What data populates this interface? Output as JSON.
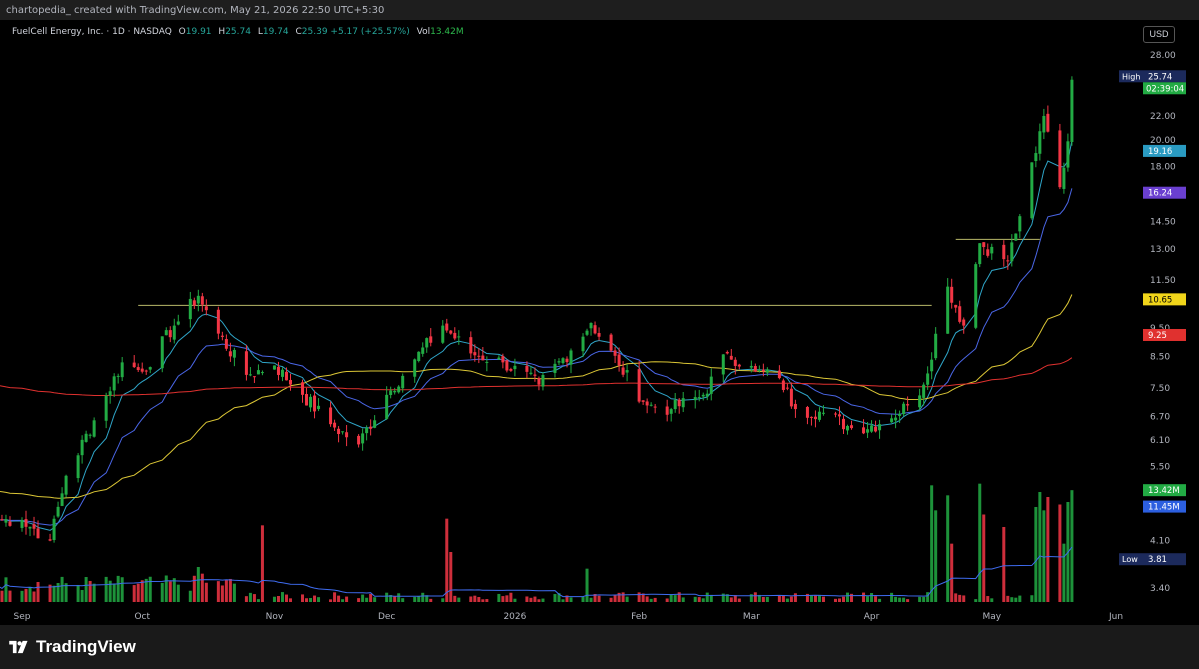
{
  "header": {
    "attribution": "chartopedia_ created with TradingView.com, May 21, 2026 22:50 UTC+5:30"
  },
  "legend": {
    "symbol": "FuelCell Energy, Inc. · 1D · NASDAQ",
    "open_label": "O",
    "open": "19.91",
    "high_label": "H",
    "high": "25.74",
    "low_label": "L",
    "low": "19.74",
    "close_label": "C",
    "close": "25.39",
    "change": "+5.17 (+25.57%)",
    "vol_label": "Vol",
    "vol": "13.42M"
  },
  "currency_button": "USD",
  "footer": {
    "brand": "TradingView"
  },
  "colors": {
    "up": "#22ab44",
    "down": "#f23645",
    "ema_short": "#2fa5c8",
    "ema_mid": "#4a66e6",
    "sma_50": "#dcc736",
    "sma_200": "#e0312f",
    "resistance": "#b9b96a",
    "vol_ma": "#3f6cf0",
    "background": "#000000"
  },
  "chart_data": {
    "type": "candlestick",
    "price_scale": "log",
    "y_ticks": [
      "28.00",
      "22.00",
      "20.00",
      "18.00",
      "14.50",
      "13.00",
      "11.50",
      "9.50",
      "8.50",
      "7.50",
      "6.70",
      "6.10",
      "5.50",
      "5.00",
      "4.10",
      "3.40"
    ],
    "x_ticks": [
      {
        "label": "Sep",
        "date": "2025-09-01"
      },
      {
        "label": "Oct",
        "date": "2025-10-01"
      },
      {
        "label": "Nov",
        "date": "2025-11-03"
      },
      {
        "label": "Dec",
        "date": "2025-12-01"
      },
      {
        "label": "2026",
        "date": "2026-01-02"
      },
      {
        "label": "Feb",
        "date": "2026-02-02"
      },
      {
        "label": "Mar",
        "date": "2026-03-02"
      },
      {
        "label": "Apr",
        "date": "2026-04-01"
      },
      {
        "label": "May",
        "date": "2026-05-01"
      },
      {
        "label": "Jun",
        "date": "2026-06-01"
      }
    ],
    "price_labels": [
      {
        "label": "High",
        "value": "25.74",
        "price": 25.74,
        "color": "#1c2a5c",
        "sub": "02:39:04"
      },
      {
        "value": "19.16",
        "price": 19.16,
        "color": "#2a9bc2"
      },
      {
        "value": "16.24",
        "price": 16.24,
        "color": "#6a3fd0"
      },
      {
        "value": "10.65",
        "price": 10.65,
        "color": "#f1d51a"
      },
      {
        "value": "9.25",
        "price": 9.25,
        "color": "#e0312f"
      },
      {
        "value": "13.42M",
        "volume": 13.42,
        "color": "#22ab44"
      },
      {
        "value": "11.45M",
        "volume": 11.45,
        "color": "#2c5fe0"
      },
      {
        "label": "Low",
        "value": "3.81",
        "price": 3.81,
        "color": "#1c2a5c"
      }
    ],
    "resistance_lines": [
      {
        "from": "2025-09-30",
        "to": "2026-04-16",
        "price": 10.4
      },
      {
        "from": "2026-04-22",
        "to": "2026-05-13",
        "price": 13.5
      }
    ],
    "close_anchors": [
      [
        "2025-09-01",
        4.45
      ],
      [
        "2025-09-08",
        4.1
      ],
      [
        "2025-09-12",
        5.3
      ],
      [
        "2025-09-19",
        6.6
      ],
      [
        "2025-09-26",
        8.3
      ],
      [
        "2025-10-01",
        8.0
      ],
      [
        "2025-10-09",
        9.6
      ],
      [
        "2025-10-15",
        10.8
      ],
      [
        "2025-10-20",
        9.3
      ],
      [
        "2025-10-27",
        7.9
      ],
      [
        "2025-11-03",
        8.2
      ],
      [
        "2025-11-10",
        7.3
      ],
      [
        "2025-11-17",
        6.5
      ],
      [
        "2025-11-24",
        6.0
      ],
      [
        "2025-12-01",
        7.3
      ],
      [
        "2025-12-08",
        8.4
      ],
      [
        "2025-12-15",
        9.6
      ],
      [
        "2025-12-22",
        8.6
      ],
      [
        "2025-12-30",
        8.3
      ],
      [
        "2026-01-08",
        7.6
      ],
      [
        "2026-01-16",
        8.7
      ],
      [
        "2026-01-21",
        9.7
      ],
      [
        "2026-01-28",
        8.2
      ],
      [
        "2026-02-04",
        7.0
      ],
      [
        "2026-02-10",
        6.9
      ],
      [
        "2026-02-18",
        7.3
      ],
      [
        "2026-02-24",
        8.6
      ],
      [
        "2026-03-03",
        8.0
      ],
      [
        "2026-03-09",
        7.8
      ],
      [
        "2026-03-13",
        6.9
      ],
      [
        "2026-03-20",
        6.8
      ],
      [
        "2026-03-27",
        6.4
      ],
      [
        "2026-04-03",
        6.5
      ],
      [
        "2026-04-10",
        7.0
      ],
      [
        "2026-04-14",
        7.6
      ],
      [
        "2026-04-20",
        11.2
      ],
      [
        "2026-04-24",
        9.6
      ],
      [
        "2026-04-28",
        13.3
      ],
      [
        "2026-05-05",
        12.4
      ],
      [
        "2026-05-08",
        14.8
      ],
      [
        "2026-05-12",
        19.0
      ],
      [
        "2026-05-14",
        22.0
      ],
      [
        "2026-05-18",
        16.6
      ],
      [
        "2026-05-20",
        19.9
      ],
      [
        "2026-05-21",
        25.39
      ]
    ],
    "volume_events": [
      [
        "2025-10-15",
        4.2
      ],
      [
        "2025-10-16",
        3.4
      ],
      [
        "2025-10-31",
        9.2
      ],
      [
        "2025-12-16",
        10.0
      ],
      [
        "2025-12-17",
        6.0
      ],
      [
        "2026-01-20",
        4.0
      ],
      [
        "2026-04-16",
        14.0
      ],
      [
        "2026-04-17",
        11.0
      ],
      [
        "2026-04-20",
        12.8
      ],
      [
        "2026-04-21",
        7.0
      ],
      [
        "2026-04-28",
        14.2
      ],
      [
        "2026-04-29",
        10.5
      ],
      [
        "2026-05-04",
        9.0
      ],
      [
        "2026-05-12",
        11.4
      ],
      [
        "2026-05-13",
        13.2
      ],
      [
        "2026-05-14",
        11.0
      ],
      [
        "2026-05-15",
        12.6
      ],
      [
        "2026-05-18",
        11.7
      ],
      [
        "2026-05-19",
        7.0
      ],
      [
        "2026-05-20",
        12.0
      ],
      [
        "2026-05-21",
        13.42
      ]
    ],
    "volume_range_millions": [
      0,
      18
    ]
  }
}
